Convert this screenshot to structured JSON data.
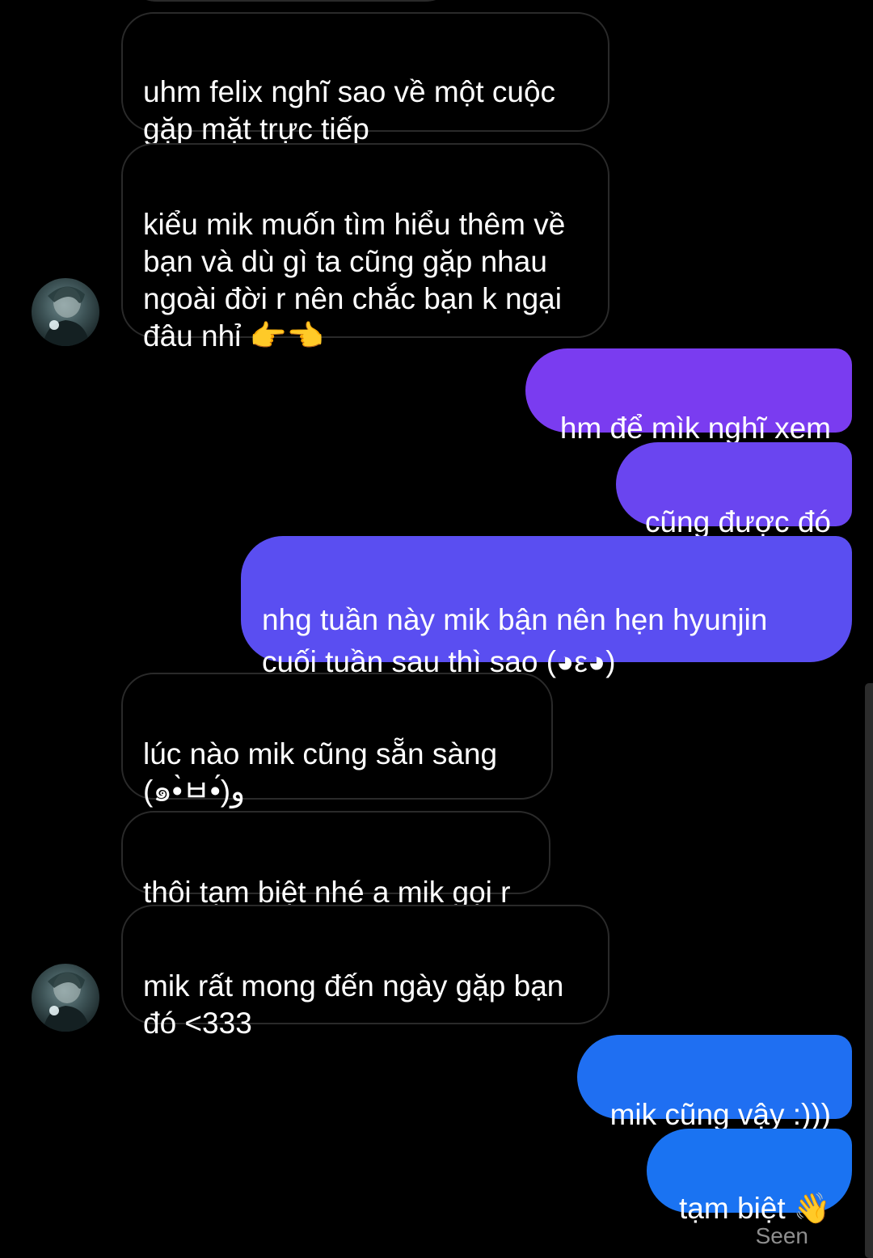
{
  "colors": {
    "background": "#000000",
    "incoming_border": "#2a2a2a",
    "outgoing_purple": "#7a3cf0",
    "outgoing_blue": "#1f6ff2"
  },
  "messages": [
    {
      "sender": "them",
      "text": "uhm felix nghĩ sao về một cuộc\ngặp mặt trực tiếp"
    },
    {
      "sender": "them",
      "text": "kiểu mik muốn tìm hiểu thêm về\nbạn và dù gì ta cũng gặp nhau\nngoài đời r nên chắc bạn k ngại\nđâu nhỉ 👉👈"
    },
    {
      "sender": "me",
      "text": "hm để mìk nghĩ xem"
    },
    {
      "sender": "me",
      "text": "cũng được đó"
    },
    {
      "sender": "me",
      "text": "nhg tuần này mik bận nên hẹn hyunjin\ncuối tuần sau thì sao (◕ε◕)"
    },
    {
      "sender": "them",
      "text": "lúc nào mik cũng sẵn sàng\n(๑•̀ㅂ•́)و"
    },
    {
      "sender": "them",
      "text": "thôi tạm biệt nhé a mik gọi r"
    },
    {
      "sender": "them",
      "text": "mik rất mong đến ngày gặp bạn\nđó <333"
    },
    {
      "sender": "me",
      "text": "mik cũng vậy :)))"
    },
    {
      "sender": "me",
      "text": "tạm biệt 👋"
    }
  ],
  "status": {
    "seen_label": "Seen"
  },
  "icons": {
    "avatar": "profile-photo-avatar"
  }
}
